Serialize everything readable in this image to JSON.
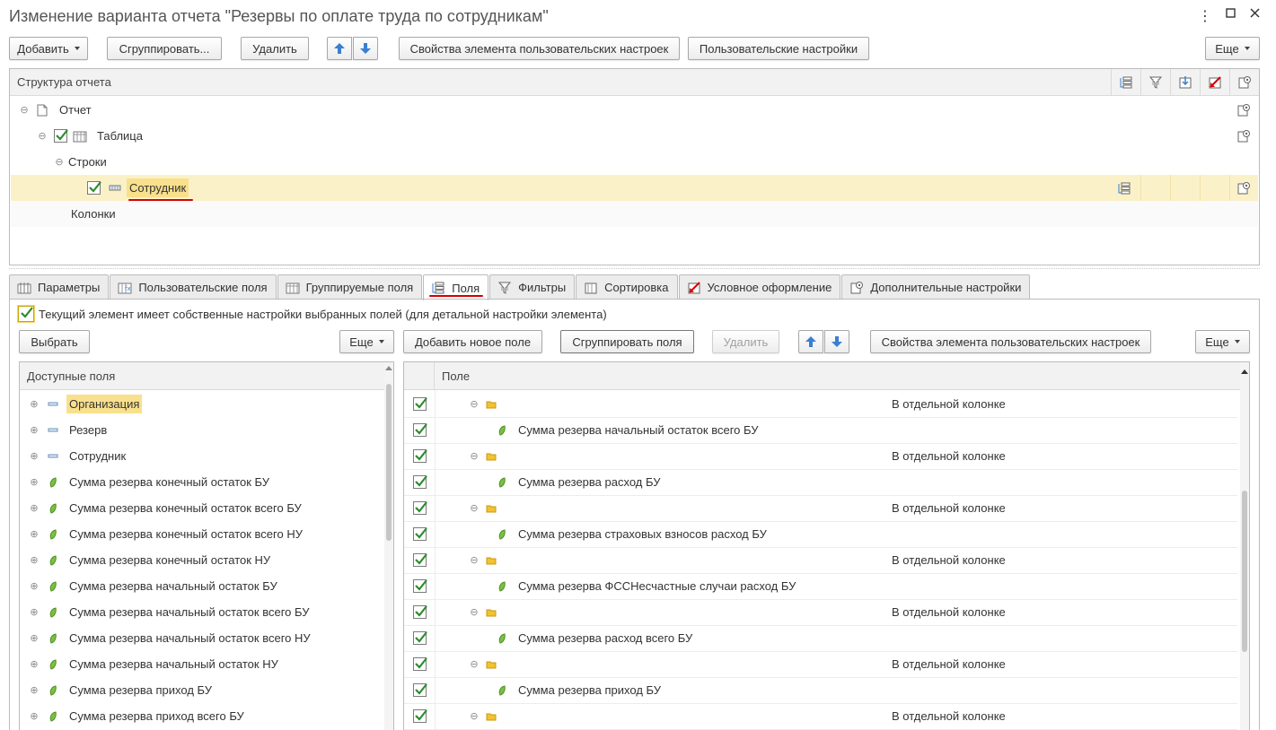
{
  "window": {
    "title": "Изменение варианта отчета \"Резервы по оплате труда по сотрудникам\"",
    "controls": {
      "more": "⋮",
      "maximize": "☐",
      "close": "✕"
    }
  },
  "toolbar": {
    "add_label": "Добавить",
    "group_label": "Сгруппировать...",
    "delete_label": "Удалить",
    "props_label": "Свойства элемента пользовательских настроек",
    "user_settings_label": "Пользовательские настройки",
    "more_label": "Еще"
  },
  "structure": {
    "header": "Структура отчета",
    "items": {
      "report": "Отчет",
      "table": "Таблица",
      "rows": "Строки",
      "employee": "Сотрудник",
      "columns": "Колонки"
    }
  },
  "tabs": [
    {
      "label": "Параметры",
      "icon": "parameters-icon"
    },
    {
      "label": "Пользовательские поля",
      "icon": "user-fields-icon"
    },
    {
      "label": "Группируемые поля",
      "icon": "grouping-fields-icon"
    },
    {
      "label": "Поля",
      "icon": "fields-icon",
      "active": true
    },
    {
      "label": "Фильтры",
      "icon": "filter-icon"
    },
    {
      "label": "Сортировка",
      "icon": "sort-icon"
    },
    {
      "label": "Условное оформление",
      "icon": "conditional-format-icon"
    },
    {
      "label": "Дополнительные настройки",
      "icon": "extra-settings-icon"
    }
  ],
  "fields_tab": {
    "own_settings_label": "Текущий элемент имеет собственные настройки выбранных полей (для детальной настройки элемента)",
    "select_label": "Выбрать",
    "more_label": "Еще",
    "add_field_label": "Добавить новое поле",
    "group_fields_label": "Сгруппировать поля",
    "delete_label": "Удалить",
    "props_label": "Свойства элемента пользовательских настроек",
    "more2_label": "Еще"
  },
  "available_fields": {
    "header": "Доступные поля",
    "items": [
      {
        "label": "Организация",
        "kind": "dimension",
        "highlight": true
      },
      {
        "label": "Резерв",
        "kind": "dimension"
      },
      {
        "label": "Сотрудник",
        "kind": "dimension"
      },
      {
        "label": "Сумма резерва конечный остаток БУ",
        "kind": "resource"
      },
      {
        "label": "Сумма резерва конечный остаток всего БУ",
        "kind": "resource"
      },
      {
        "label": "Сумма резерва конечный остаток всего НУ",
        "kind": "resource"
      },
      {
        "label": "Сумма резерва конечный остаток НУ",
        "kind": "resource"
      },
      {
        "label": "Сумма резерва начальный остаток БУ",
        "kind": "resource"
      },
      {
        "label": "Сумма резерва начальный остаток всего БУ",
        "kind": "resource"
      },
      {
        "label": "Сумма резерва начальный остаток всего НУ",
        "kind": "resource"
      },
      {
        "label": "Сумма резерва начальный остаток НУ",
        "kind": "resource"
      },
      {
        "label": "Сумма резерва приход БУ",
        "kind": "resource"
      },
      {
        "label": "Сумма резерва приход всего БУ",
        "kind": "resource"
      }
    ]
  },
  "selected_fields": {
    "header": "Поле",
    "rows": [
      {
        "type": "group",
        "placement": "В отдельной колонке"
      },
      {
        "type": "field",
        "label": "Сумма резерва начальный остаток всего БУ"
      },
      {
        "type": "group",
        "placement": "В отдельной колонке"
      },
      {
        "type": "field",
        "label": "Сумма резерва расход БУ"
      },
      {
        "type": "group",
        "placement": "В отдельной колонке"
      },
      {
        "type": "field",
        "label": "Сумма резерва страховых взносов расход БУ"
      },
      {
        "type": "group",
        "placement": "В отдельной колонке"
      },
      {
        "type": "field",
        "label": "Сумма резерва ФССНесчастные случаи расход БУ"
      },
      {
        "type": "group",
        "placement": "В отдельной колонке"
      },
      {
        "type": "field",
        "label": "Сумма резерва расход всего БУ"
      },
      {
        "type": "group",
        "placement": "В отдельной колонке"
      },
      {
        "type": "field",
        "label": "Сумма резерва приход БУ"
      },
      {
        "type": "group",
        "placement": "В отдельной колонке"
      }
    ]
  },
  "colors": {
    "selection": "#fbf1c8",
    "highlight": "#f9e08c",
    "accent_red": "#d40000",
    "check_green": "#2e8b2e",
    "arrow_blue": "#3a7fd0"
  }
}
